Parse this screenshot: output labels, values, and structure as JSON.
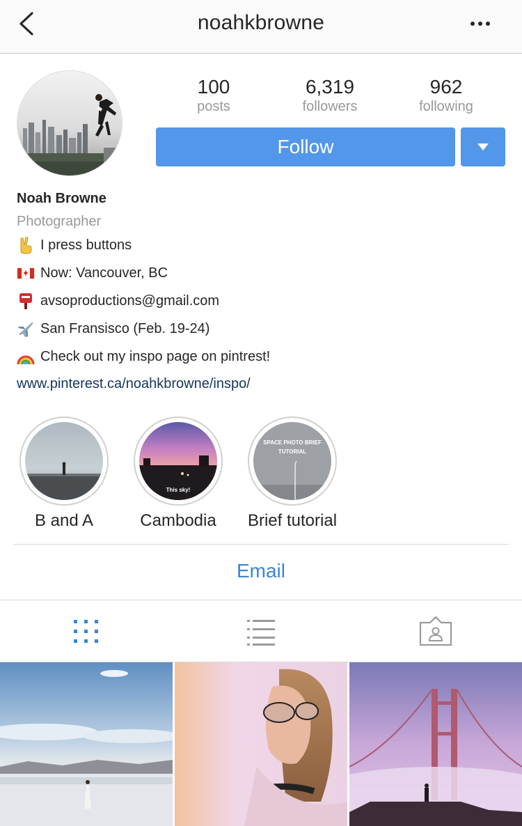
{
  "header": {
    "title": "noahkbrowne"
  },
  "stats": [
    {
      "value": "100",
      "label": "posts"
    },
    {
      "value": "6,319",
      "label": "followers"
    },
    {
      "value": "962",
      "label": "following"
    }
  ],
  "actions": {
    "follow_label": "Follow",
    "email_label": "Email"
  },
  "bio": {
    "name": "Noah Browne",
    "category": "Photographer",
    "lines": [
      {
        "icon": "victory-hand-icon",
        "text": "I press buttons"
      },
      {
        "icon": "canada-flag-icon",
        "text": "Now: Vancouver, BC"
      },
      {
        "icon": "postbox-icon",
        "text": "avsoproductions@gmail.com"
      },
      {
        "icon": "airplane-icon",
        "text": "San Fransisco (Feb. 19-24)"
      },
      {
        "icon": "rainbow-icon",
        "text": "Check out my inspo page on pintrest!"
      }
    ],
    "link": "www.pinterest.ca/noahkbrowne/inspo/"
  },
  "highlights": [
    {
      "label": "B and A"
    },
    {
      "label": "Cambodia",
      "thumb_text": "This sky!"
    },
    {
      "label": "Brief tutorial",
      "thumb_text_1": "SPACE PHOTO BRIEF",
      "thumb_text_2": "TUTORIAL"
    }
  ],
  "tabs": [
    {
      "name": "grid",
      "active": true
    },
    {
      "name": "list",
      "active": false
    },
    {
      "name": "tagged",
      "active": false
    }
  ],
  "colors": {
    "accent": "#5297e9",
    "link": "#3b84d6",
    "muted": "#999999",
    "active_tab": "#3b84d6"
  }
}
